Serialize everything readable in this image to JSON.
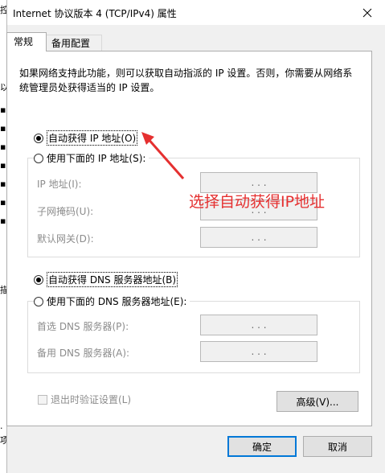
{
  "window": {
    "title": "Internet 协议版本 4 (TCP/IPv4) 属性",
    "close_icon": "close-icon"
  },
  "tabs": [
    {
      "label": "常规"
    },
    {
      "label": "备用配置"
    }
  ],
  "description": "如果网络支持此功能，则可以获取自动指派的 IP 设置。否则，你需要从网络系统管理员处获得适当的 IP 设置。",
  "ip": {
    "auto_label": "自动获得 IP 地址(O)",
    "manual_label": "使用下面的 IP 地址(S):",
    "fields": [
      {
        "label": "IP 地址(I):",
        "value": ". . ."
      },
      {
        "label": "子网掩码(U):",
        "value": ". . ."
      },
      {
        "label": "默认网关(D):",
        "value": ". . ."
      }
    ]
  },
  "dns": {
    "auto_label": "自动获得 DNS 服务器地址(B)",
    "manual_label": "使用下面的 DNS 服务器地址(E):",
    "fields": [
      {
        "label": "首选 DNS 服务器(P):",
        "value": ". . ."
      },
      {
        "label": "备用 DNS 服务器(A):",
        "value": ". . ."
      }
    ]
  },
  "annotation": "选择自动获得IP地址",
  "validate_label": "退出时验证设置(L)",
  "advanced_label": "高级(V)...",
  "ok_label": "确定",
  "cancel_label": "取消",
  "colors": {
    "annotation": "#e53030",
    "focus": "#0078d7"
  }
}
